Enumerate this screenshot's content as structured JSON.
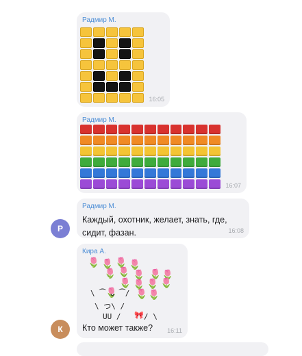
{
  "messages": [
    {
      "sender": "Радмир М.",
      "time": "16:05"
    },
    {
      "sender": "Радмир М.",
      "time": "16:07"
    },
    {
      "sender": "Радмир М.",
      "text_lines": [
        "Каждый, охотник, желает, знать, где,",
        "сидит, фазан."
      ],
      "time": "16:08",
      "avatar_letter": "Р"
    },
    {
      "sender": "Кира А.",
      "art_lines": [
        "\\ ⁀ ᴗ ⁀/",
        "\\  つ\\   /",
        "UU  /",
        "/  \\"
      ],
      "text": "Кто может также?",
      "time": "16:11",
      "avatar_letter": "К"
    }
  ],
  "colors": {
    "sender": "#4e8fd6",
    "bubble": "#f1f1f4",
    "avatar_r": "#7b7fd4",
    "avatar_k": "#c88d5c",
    "yellow": "#f6c43c",
    "black": "#141414",
    "rainbow": [
      "#d8322e",
      "#f08a24",
      "#f4c433",
      "#3fab3c",
      "#3478d8",
      "#9b4bd6"
    ]
  },
  "icons": {
    "flower": "cherry-blossom-emoji",
    "bow": "ribbon-emoji"
  },
  "grids": {
    "emoji_face": [
      [
        "y",
        "y",
        "y",
        "y",
        "y"
      ],
      [
        "y",
        "b",
        "y",
        "b",
        "y"
      ],
      [
        "y",
        "b",
        "y",
        "b",
        "y"
      ],
      [
        "y",
        "y",
        "y",
        "y",
        "y"
      ],
      [
        "y",
        "b",
        "y",
        "b",
        "y"
      ],
      [
        "y",
        "b",
        "b",
        "b",
        "y"
      ],
      [
        "y",
        "y",
        "y",
        "y",
        "y"
      ]
    ],
    "rainbow_rows": 6,
    "rainbow_cols": 11
  }
}
